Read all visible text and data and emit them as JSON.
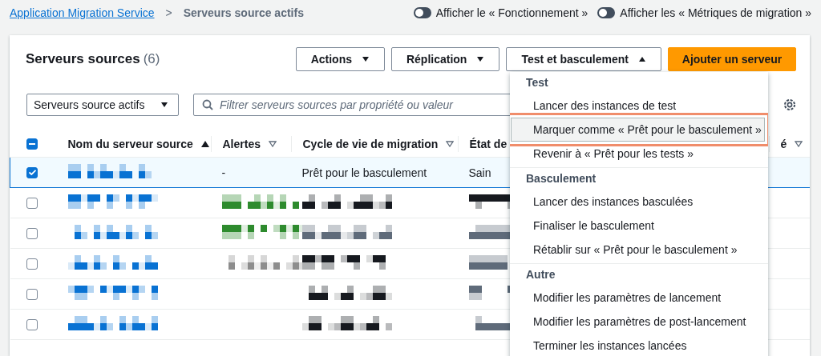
{
  "breadcrumb": {
    "link": "Application Migration Service",
    "separator": ">",
    "current": "Serveurs source actifs"
  },
  "toggles": [
    {
      "label": "Afficher le « Fonctionnement »",
      "on": false
    },
    {
      "label": "Afficher les « Métriques de migration »",
      "on": false
    }
  ],
  "panel": {
    "title": "Serveurs sources",
    "count": "(6)",
    "buttons": [
      {
        "label": "Actions",
        "kind": "dropdown",
        "expanded": false
      },
      {
        "label": "Réplication",
        "kind": "dropdown",
        "expanded": false
      },
      {
        "label": "Test et basculement",
        "kind": "dropdown",
        "expanded": true
      },
      {
        "label": "Ajouter un serveur",
        "kind": "primary"
      }
    ],
    "filter_select": {
      "value": "Serveurs source actifs"
    },
    "search": {
      "placeholder": "Filtrer serveurs sources par propriété ou valeur"
    }
  },
  "table": {
    "select_all": {
      "indeterminate": true
    },
    "columns": [
      {
        "label": "Nom du serveur source",
        "sorted": true
      },
      {
        "label": "Alertes",
        "sorted": false
      },
      {
        "label": "Cycle de vie de migration",
        "sorted": false
      },
      {
        "label": "État de"
      },
      {
        "label": "é",
        "sorted": false
      }
    ],
    "rows": [
      {
        "selected": true,
        "cells": [
          {
            "kind": "redacted",
            "color": "#0972d3"
          },
          {
            "kind": "text",
            "text": "-"
          },
          {
            "kind": "text",
            "text": "Prêt pour le basculement"
          },
          {
            "kind": "text",
            "text": "Sain"
          }
        ]
      },
      {
        "selected": false,
        "cells": [
          {
            "kind": "redacted",
            "color": "#0972d3"
          },
          {
            "kind": "redacted",
            "color": "#2e8b2e"
          },
          {
            "kind": "redacted",
            "color": "#16191f"
          },
          {
            "kind": "redacted",
            "color": "#16191f"
          }
        ]
      },
      {
        "selected": false,
        "cells": [
          {
            "kind": "redacted",
            "color": "#0972d3"
          },
          {
            "kind": "redacted",
            "color": "#2e8b2e"
          },
          {
            "kind": "redacted",
            "color": "#5f6b7a"
          },
          {
            "kind": "redacted",
            "color": "#5f6b7a"
          }
        ]
      },
      {
        "selected": false,
        "cells": [
          {
            "kind": "redacted",
            "color": "#0972d3"
          },
          {
            "kind": "redacted",
            "color": "#8d8d8d"
          },
          {
            "kind": "redacted",
            "color": "#16191f"
          },
          {
            "kind": "redacted",
            "color": "#5f6b7a"
          }
        ]
      },
      {
        "selected": false,
        "cells": [
          {
            "kind": "redacted",
            "color": "#0972d3"
          },
          {
            "kind": "empty"
          },
          {
            "kind": "redacted",
            "color": "#16191f"
          },
          {
            "kind": "redacted",
            "color": "#5f6b7a"
          }
        ]
      },
      {
        "selected": false,
        "cells": [
          {
            "kind": "redacted",
            "color": "#0972d3"
          },
          {
            "kind": "empty"
          },
          {
            "kind": "redacted",
            "color": "#16191f"
          },
          {
            "kind": "redacted",
            "color": "#5f6b7a"
          }
        ]
      }
    ]
  },
  "menu": {
    "groups": [
      {
        "heading": "Test",
        "items": [
          {
            "label": "Lancer des instances de test",
            "highlighted": false
          },
          {
            "label": "Marquer comme « Prêt pour le basculement »",
            "highlighted": true
          },
          {
            "label": "Revenir à « Prêt pour les tests »",
            "highlighted": false
          }
        ]
      },
      {
        "heading": "Basculement",
        "items": [
          {
            "label": "Lancer des instances basculées",
            "highlighted": false
          },
          {
            "label": "Finaliser le basculement",
            "highlighted": false
          },
          {
            "label": "Rétablir sur « Prêt pour le basculement »",
            "highlighted": false
          }
        ]
      },
      {
        "heading": "Autre",
        "items": [
          {
            "label": "Modifier les paramètres de lancement",
            "highlighted": false
          },
          {
            "label": "Modifier les paramètres de post-lancement",
            "highlighted": false
          },
          {
            "label": "Terminer les instances lancées",
            "highlighted": false
          }
        ]
      }
    ]
  }
}
